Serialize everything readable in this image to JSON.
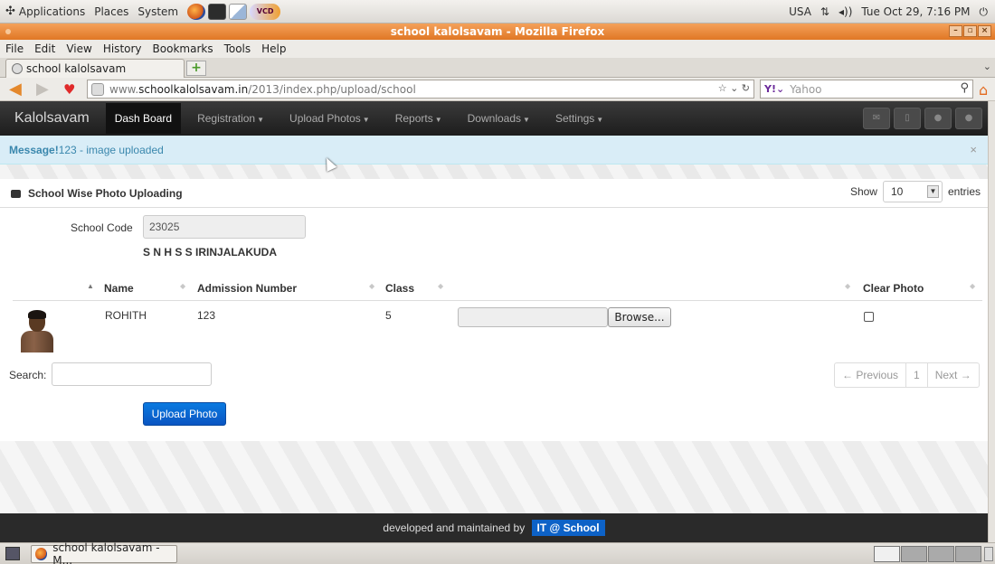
{
  "panel": {
    "menus": [
      "Applications",
      "Places",
      "System"
    ],
    "launchers": [
      {
        "icon": "firefox-icon"
      },
      {
        "icon": "terminal-icon"
      },
      {
        "icon": "text-editor-icon"
      },
      {
        "icon": "vcd-dvd-player-icon",
        "label": "VCD DVD"
      }
    ],
    "keyboard": "USA",
    "datetime": "Tue Oct 29,  7:16 PM",
    "power_icon": "power-icon"
  },
  "window": {
    "title": "school kalolsavam - Mozilla Firefox",
    "menu": [
      "File",
      "Edit",
      "View",
      "History",
      "Bookmarks",
      "Tools",
      "Help"
    ]
  },
  "browser": {
    "tab_title": "school kalolsavam",
    "url_prefix": "www.",
    "url_domain": "schoolkalolsavam.in",
    "url_path": "/2013/index.php/upload/school",
    "search_engine": "Yahoo",
    "search_placeholder": "Yahoo"
  },
  "site": {
    "brand": "Kalolsavam",
    "nav": [
      {
        "label": "Dash Board",
        "active": true
      },
      {
        "label": "Registration",
        "dropdown": true
      },
      {
        "label": "Upload Photos",
        "dropdown": true
      },
      {
        "label": "Reports",
        "dropdown": true
      },
      {
        "label": "Downloads",
        "dropdown": true
      },
      {
        "label": "Settings",
        "dropdown": true
      }
    ],
    "alert": {
      "prefix": "Message!",
      "text": "123 - image uploaded",
      "close": "×"
    },
    "box_title": "School Wise Photo Uploading",
    "show_label": "Show",
    "entries_value": "10",
    "entries_label": "entries",
    "school_code_label": "School Code",
    "school_code_value": "23025",
    "school_name": "S N H S S IRINJALAKUDA",
    "table": {
      "columns": [
        "Name",
        "Admission Number",
        "Class",
        "Clear Photo"
      ],
      "rows": [
        {
          "name": "ROHITH",
          "admission_number": "123",
          "class": "5",
          "browse_label": "Browse...",
          "clear_photo": false
        }
      ]
    },
    "search_label": "Search:",
    "pager": {
      "previous": "← Previous",
      "page": "1",
      "next": "Next →"
    },
    "upload_button": "Upload Photo",
    "footer_text": "developed and maintained by",
    "footer_logo": "IT @ School"
  },
  "taskbar": {
    "task_label": "school kalolsavam - M..."
  },
  "colors": {
    "titlebar": "#e07724",
    "site_nav": "#1d1d1d",
    "alert_bg": "#d9edf7",
    "alert_text": "#3a87ad",
    "primary_button": "#0a66d4"
  }
}
